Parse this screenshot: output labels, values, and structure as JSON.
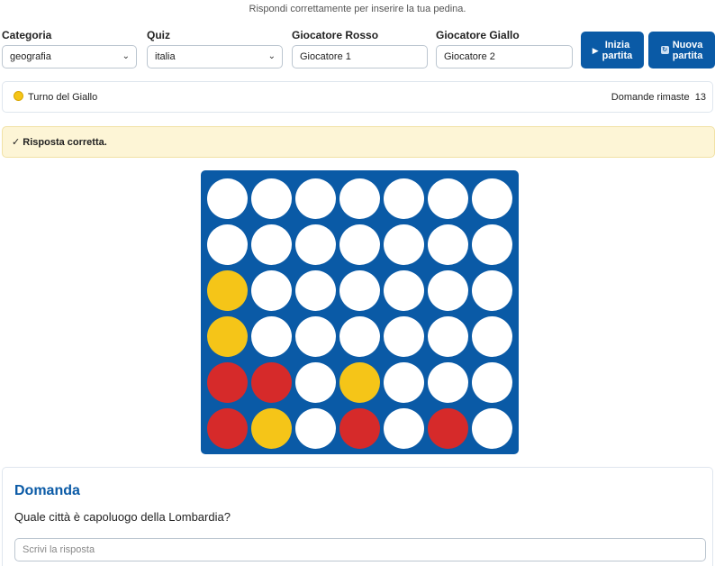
{
  "subtitle": "Rispondi correttamente per inserire la tua pedina.",
  "controls": {
    "category": {
      "label": "Categoria",
      "value": "geografia"
    },
    "quiz": {
      "label": "Quiz",
      "value": "italia"
    },
    "player_red": {
      "label": "Giocatore Rosso",
      "value": "Giocatore 1"
    },
    "player_yellow": {
      "label": "Giocatore Giallo",
      "value": "Giocatore 2"
    },
    "start_button": {
      "line1": "Inizia",
      "line2": "partita",
      "icon": "play-icon"
    },
    "new_button": {
      "line1": "Nuova",
      "line2": "partita",
      "icon": "reset-icon"
    }
  },
  "status": {
    "turn": "Turno del Giallo",
    "remaining_label": "Domande rimaste",
    "remaining_count": "13"
  },
  "feedback": "✓ Risposta corretta.",
  "board": {
    "columns": 7,
    "rows": 6,
    "colors": {
      "board": "#0a5aa6",
      "red": "#d62a2a",
      "yellow": "#f5c518",
      "empty": "#ffffff"
    },
    "cells": [
      [
        "E",
        "E",
        "E",
        "E",
        "E",
        "E",
        "E"
      ],
      [
        "E",
        "E",
        "E",
        "E",
        "E",
        "E",
        "E"
      ],
      [
        "Y",
        "E",
        "E",
        "E",
        "E",
        "E",
        "E"
      ],
      [
        "Y",
        "E",
        "E",
        "E",
        "E",
        "E",
        "E"
      ],
      [
        "R",
        "R",
        "E",
        "Y",
        "E",
        "E",
        "E"
      ],
      [
        "R",
        "Y",
        "E",
        "R",
        "E",
        "R",
        "E"
      ]
    ]
  },
  "question": {
    "heading": "Domanda",
    "text": "Quale città è capoluogo della Lombardia?",
    "placeholder": "Scrivi la risposta"
  }
}
